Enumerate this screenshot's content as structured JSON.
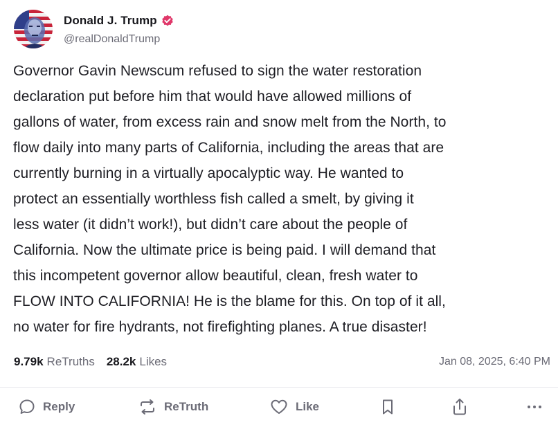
{
  "author": {
    "display_name": "Donald J. Trump",
    "handle": "@realDonaldTrump",
    "verified": true,
    "verified_color": "#e0386a"
  },
  "post": {
    "text": "Governor Gavin Newscum refused to sign the water restoration\ndeclaration put before him that would have allowed millions of\ngallons of water, from excess rain and snow melt from the North, to\nflow daily into many parts of California, including the areas that are\ncurrently burning in a virtually apocalyptic way. He wanted to\nprotect an essentially worthless fish  called a smelt, by giving it\nless water (it didn’t work!), but didn’t care about the people of\nCalifornia. Now the ultimate price is being paid. I will demand that\nthis incompetent governor allow beautiful, clean, fresh water to\nFLOW INTO CALIFORNIA! He is the blame for this. On top of it all,\nno water for fire hydrants, not firefighting planes. A true disaster!"
  },
  "stats": {
    "retruths_count": "9.79k",
    "retruths_label": "ReTruths",
    "likes_count": "28.2k",
    "likes_label": "Likes",
    "timestamp": "Jan 08, 2025, 6:40 PM"
  },
  "actions": {
    "reply_label": "Reply",
    "retruth_label": "ReTruth",
    "like_label": "Like",
    "bookmark_icon": "bookmark-icon",
    "share_icon": "share-icon",
    "more_icon": "more-icon"
  },
  "colors": {
    "text": "#1e1e24",
    "muted": "#6b6b76",
    "divider": "#e7e7ec",
    "accent": "#e0386a"
  }
}
